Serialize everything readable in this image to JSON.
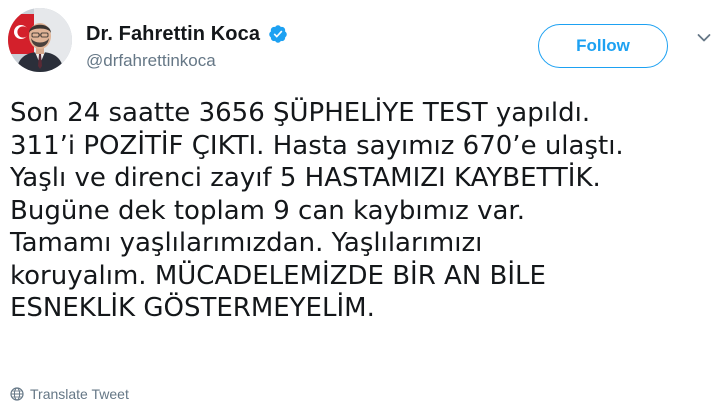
{
  "author": {
    "display_name": "Dr. Fahrettin Koca",
    "handle": "@drfahrettinkoca",
    "verified_icon": "verified-badge-icon",
    "avatar": "profile-photo"
  },
  "follow": {
    "label": "Follow"
  },
  "tweet": {
    "lines": [
      "Son 24 saatte 3656 ŞÜPHELİYE TEST yapıldı.",
      "311’i POZİTİF ÇIKTI. Hasta sayımız 670’e ulaştı.",
      "Yaşlı ve direnci zayıf 5 HASTAMIZI KAYBETTİK.",
      "Bugüne dek toplam 9 can kaybımız var.",
      "Tamamı yaşlılarımızdan. Yaşlılarımızı",
      "koruyalım. MÜCADELEMİZDE BİR AN BİLE",
      "ESNEKLİK GÖSTERMEYELİM."
    ]
  },
  "translate": {
    "label": "Translate Tweet",
    "icon": "globe-icon"
  },
  "colors": {
    "accent": "#1da1f2",
    "text": "#14171a",
    "secondary_text": "#657786",
    "background": "#ffffff"
  }
}
